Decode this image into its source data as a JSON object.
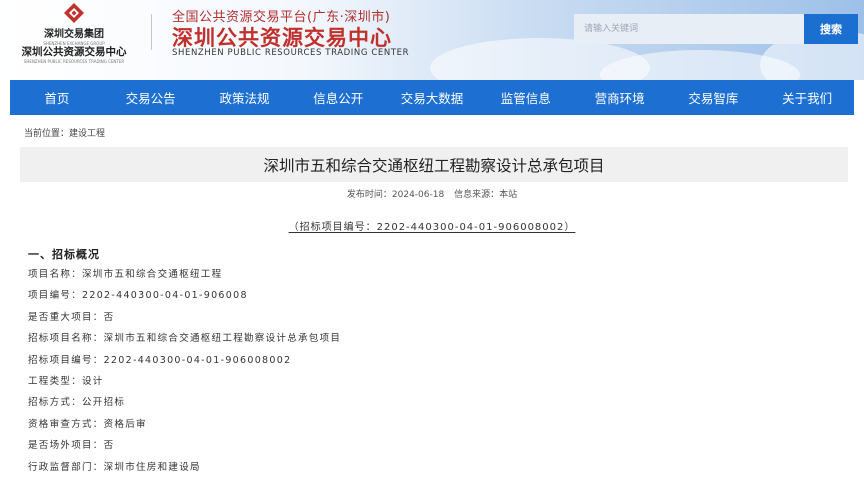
{
  "header": {
    "logo_cn_1": "深圳交易集团",
    "logo_en_1": "SHENZHEN EXCHANGE GROUP",
    "logo_cn_2": "深圳公共资源交易中心",
    "logo_en_2": "SHENZHEN PUBLIC RESOURCES TRADING CENTER",
    "platform_line": "全国公共资源交易平台(广东·深圳市)",
    "site_title": "深圳公共资源交易中心",
    "site_title_en": "SHENZHEN PUBLIC RESOURCES TRADING CENTER",
    "search_placeholder": "请输入关键词",
    "search_button": "搜索"
  },
  "nav": {
    "items": [
      "首页",
      "交易公告",
      "政策法规",
      "信息公开",
      "交易大数据",
      "监管信息",
      "营商环境",
      "交易智库",
      "关于我们"
    ]
  },
  "breadcrumb": "当前位置：建设工程",
  "article": {
    "title": "深圳市五和综合交通枢纽工程勘察设计总承包项目",
    "publish_time": "发布时间：2024-06-18",
    "source": "信息来源：本站",
    "code_line": "（招标项目编号：2202-440300-04-01-906008002）",
    "section_title": "一、招标概况",
    "rows": [
      "项目名称：深圳市五和综合交通枢纽工程",
      "项目编号：2202-440300-04-01-906008",
      "是否重大项目：否",
      "招标项目名称：深圳市五和综合交通枢纽工程勘察设计总承包项目",
      "招标项目编号：2202-440300-04-01-906008002",
      "工程类型：设计",
      "招标方式：公开招标",
      "资格审查方式：资格后审",
      "是否场外项目：否",
      "行政监督部门：深圳市住房和建设局"
    ]
  },
  "colors": {
    "nav_blue": "#1d70d1",
    "search_button": "#1a6fd0",
    "brand_red": "#c0302c"
  }
}
